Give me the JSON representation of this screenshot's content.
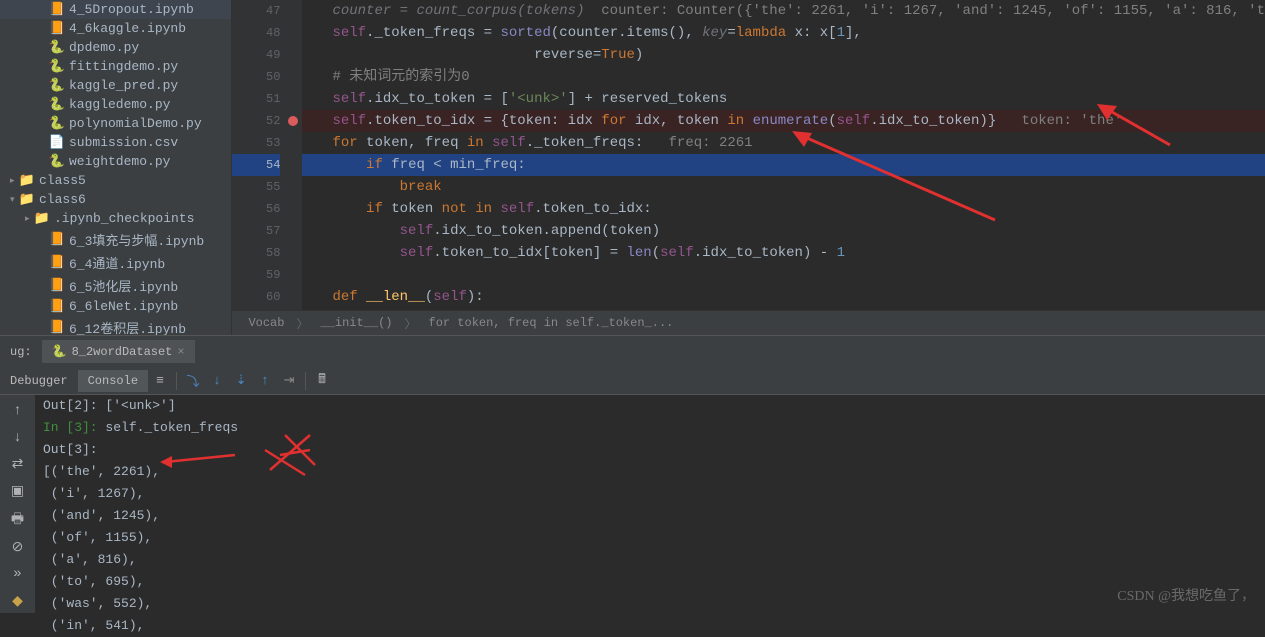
{
  "sidebar": {
    "items": [
      {
        "label": "4_5Dropout.ipynb",
        "type": "ipynb",
        "indent": 2
      },
      {
        "label": "4_6kaggle.ipynb",
        "type": "ipynb",
        "indent": 2
      },
      {
        "label": "dpdemo.py",
        "type": "py",
        "indent": 2
      },
      {
        "label": "fittingdemo.py",
        "type": "py",
        "indent": 2
      },
      {
        "label": "kaggle_pred.py",
        "type": "py",
        "indent": 2
      },
      {
        "label": "kaggledemo.py",
        "type": "py",
        "indent": 2
      },
      {
        "label": "polynomialDemo.py",
        "type": "py",
        "indent": 2
      },
      {
        "label": "submission.csv",
        "type": "csv",
        "indent": 2
      },
      {
        "label": "weightdemo.py",
        "type": "py",
        "indent": 2
      },
      {
        "label": "class5",
        "type": "folder",
        "indent": 0,
        "chevron": "right"
      },
      {
        "label": "class6",
        "type": "folder",
        "indent": 0,
        "chevron": "down"
      },
      {
        "label": ".ipynb_checkpoints",
        "type": "folder",
        "indent": 1,
        "chevron": "right"
      },
      {
        "label": "6_3填充与步幅.ipynb",
        "type": "ipynb",
        "indent": 2
      },
      {
        "label": "6_4通道.ipynb",
        "type": "ipynb",
        "indent": 2
      },
      {
        "label": "6_5池化层.ipynb",
        "type": "ipynb",
        "indent": 2
      },
      {
        "label": "6_6leNet.ipynb",
        "type": "ipynb",
        "indent": 2
      },
      {
        "label": "6_12卷积层.ipynb",
        "type": "ipynb",
        "indent": 2
      }
    ]
  },
  "gutter": {
    "start": 47,
    "lines": [
      "47",
      "48",
      "49",
      "50",
      "51",
      "52",
      "53",
      "54",
      "55",
      "56",
      "57",
      "58",
      "59",
      "60"
    ],
    "breakpoint_line": "52",
    "current_line": "54"
  },
  "code": {
    "line47_a": "counter = count_corpus(tokens)  ",
    "line47_b": "counter: Counter({'the': 2261, 'i': 1267, 'and': 1245, 'of': 1155, 'a': 816, 't",
    "line48": "._token_freqs = ",
    "line48b": "(counter.items(), ",
    "line48c": "=",
    "line48d": " x: x[",
    "line48e": "],",
    "line49": "                        reverse=",
    "line49b": ")",
    "line50": "# 未知词元的索引为0",
    "line51a": ".idx_to_token = [",
    "line51b": "'<unk>'",
    "line51c": "] + reserved_tokens",
    "line52a": ".token_to_idx = {token: idx ",
    "line52b": " idx, token ",
    "line52c": "(",
    "line52d": ".idx_to_token)}   ",
    "line52e": "token: 'the'",
    "line53a": " token, freq ",
    "line53b": "._token_freqs:   ",
    "line53c": "freq: 2261",
    "line54a": " freq < min_freq:",
    "line55": "break",
    "line56a": " token ",
    "line56b": ".token_to_idx:",
    "line57a": ".idx_to_token.append(token)",
    "line58a": ".token_to_idx[token] = ",
    "line58b": "(",
    "line58c": ".idx_to_token) - ",
    "line58d": "1",
    "line60a": "(",
    "line60b": "):"
  },
  "breadcrumb": {
    "items": [
      "Vocab",
      "__init__()",
      "for token, freq in self._token_..."
    ]
  },
  "debug": {
    "label": "ug:",
    "tab": "8_2wordDataset",
    "tool_tabs": [
      "Debugger",
      "Console"
    ],
    "console": [
      {
        "type": "out",
        "text": "Out[2]: ['<unk>']"
      },
      {
        "type": "in",
        "prompt": "In [3]: ",
        "text": "self._token_freqs"
      },
      {
        "type": "out",
        "text": "Out[3]:"
      },
      {
        "type": "plain",
        "text": "[('the', 2261),"
      },
      {
        "type": "plain",
        "text": " ('i', 1267),"
      },
      {
        "type": "plain",
        "text": " ('and', 1245),"
      },
      {
        "type": "plain",
        "text": " ('of', 1155),"
      },
      {
        "type": "plain",
        "text": " ('a', 816),"
      },
      {
        "type": "plain",
        "text": " ('to', 695),"
      },
      {
        "type": "plain",
        "text": " ('was', 552),"
      },
      {
        "type": "plain",
        "text": " ('in', 541),"
      }
    ]
  },
  "watermark": "CSDN @我想吃鱼了，"
}
